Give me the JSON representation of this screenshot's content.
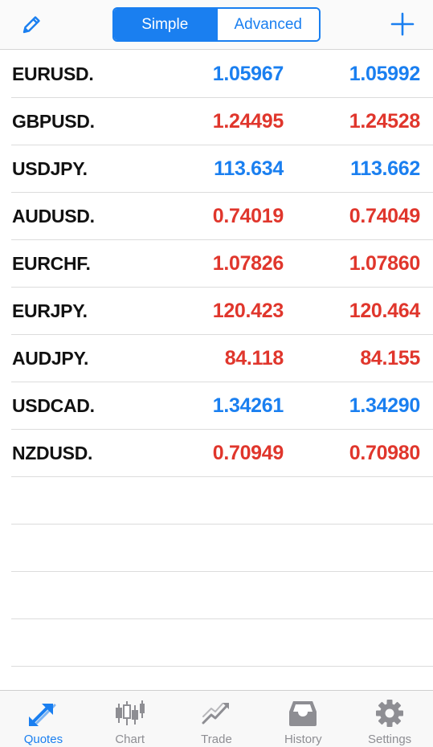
{
  "header": {
    "segments": {
      "simple_label": "Simple",
      "advanced_label": "Advanced"
    },
    "edit_icon": "pencil-icon",
    "add_icon": "plus-icon"
  },
  "colors": {
    "accent": "#1a7ff0",
    "price_up": "#1a7ff0",
    "price_down": "#e0362c"
  },
  "quotes": [
    {
      "symbol": "EURUSD.",
      "bid": "1.05967",
      "ask": "1.05992",
      "direction": "up"
    },
    {
      "symbol": "GBPUSD.",
      "bid": "1.24495",
      "ask": "1.24528",
      "direction": "down"
    },
    {
      "symbol": "USDJPY.",
      "bid": "113.634",
      "ask": "113.662",
      "direction": "up"
    },
    {
      "symbol": "AUDUSD.",
      "bid": "0.74019",
      "ask": "0.74049",
      "direction": "down"
    },
    {
      "symbol": "EURCHF.",
      "bid": "1.07826",
      "ask": "1.07860",
      "direction": "down"
    },
    {
      "symbol": "EURJPY.",
      "bid": "120.423",
      "ask": "120.464",
      "direction": "down"
    },
    {
      "symbol": "AUDJPY.",
      "bid": "84.118",
      "ask": "84.155",
      "direction": "down"
    },
    {
      "symbol": "USDCAD.",
      "bid": "1.34261",
      "ask": "1.34290",
      "direction": "up"
    },
    {
      "symbol": "NZDUSD.",
      "bid": "0.70949",
      "ask": "0.70980",
      "direction": "down"
    }
  ],
  "tabbar": {
    "tabs": [
      {
        "label": "Quotes",
        "icon": "quotes-arrows-icon",
        "active": true
      },
      {
        "label": "Chart",
        "icon": "candlestick-chart-icon",
        "active": false
      },
      {
        "label": "Trade",
        "icon": "trade-trend-icon",
        "active": false
      },
      {
        "label": "History",
        "icon": "inbox-tray-icon",
        "active": false
      },
      {
        "label": "Settings",
        "icon": "gear-icon",
        "active": false
      }
    ]
  }
}
